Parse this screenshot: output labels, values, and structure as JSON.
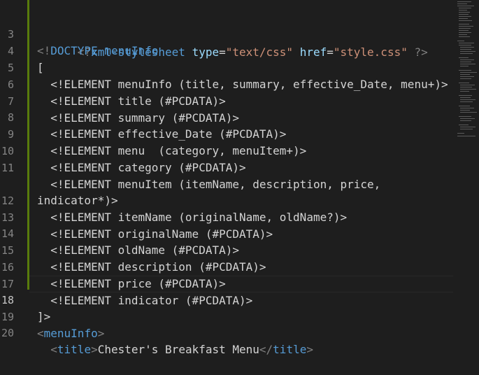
{
  "editor": {
    "lines": [
      {
        "num": "",
        "code": "<?xml-stylesheet type=\"text/css\" href=\"style.css\" ?>"
      },
      {
        "num": "3",
        "code": "<!DOCTYPE menuInfo"
      },
      {
        "num": "4",
        "code": "["
      },
      {
        "num": "5",
        "code": "  <!ELEMENT menuInfo (title, summary, effective_Date, menu+)>"
      },
      {
        "num": "6",
        "code": "  <!ELEMENT title (#PCDATA)>"
      },
      {
        "num": "7",
        "code": "  <!ELEMENT summary (#PCDATA)>"
      },
      {
        "num": "8",
        "code": "  <!ELEMENT effective_Date (#PCDATA)>"
      },
      {
        "num": "9",
        "code": "  <!ELEMENT menu  (category, menuItem+)>"
      },
      {
        "num": "10",
        "code": "  <!ELEMENT category (#PCDATA)>"
      },
      {
        "num": "11",
        "code": "  <!ELEMENT menuItem (itemName, description, price,"
      },
      {
        "num": "",
        "code": "indicator*)>"
      },
      {
        "num": "12",
        "code": "  <!ELEMENT itemName (originalName, oldName?)>"
      },
      {
        "num": "13",
        "code": "  <!ELEMENT originalName (#PCDATA)>"
      },
      {
        "num": "14",
        "code": "  <!ELEMENT oldName (#PCDATA)>"
      },
      {
        "num": "15",
        "code": "  <!ELEMENT description (#PCDATA)>"
      },
      {
        "num": "16",
        "code": "  <!ELEMENT price (#PCDATA)>"
      },
      {
        "num": "17",
        "code": "  <!ELEMENT indicator (#PCDATA)>"
      },
      {
        "num": "18",
        "code": "]>"
      },
      {
        "num": "19",
        "code": "<menuInfo>"
      },
      {
        "num": "20",
        "code": "  <title>Chester's Breakfast Menu</title>"
      }
    ]
  },
  "colors": {
    "background": "#1e1e1e",
    "gutter_added": "#587c0c",
    "tag": "#569cd6",
    "attribute": "#9cdcfe",
    "string": "#ce9178",
    "punctuation": "#808080",
    "text": "#d4d4d4"
  }
}
